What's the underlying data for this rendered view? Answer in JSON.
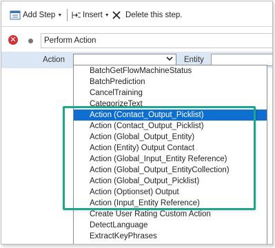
{
  "toolbar": {
    "add_step_label": "Add Step",
    "insert_label": "Insert",
    "delete_label": "Delete this step."
  },
  "step": {
    "title": "Perform Action"
  },
  "params": {
    "action_label": "Action",
    "entity_label": "Entity",
    "action_value": ""
  },
  "dropdown": {
    "options": [
      "BatchGetFlowMachineStatus",
      "BatchPrediction",
      "CancelTraining",
      "CategorizeText",
      "Action (Contact_Output_Picklist)",
      "Action (Contact_Output_Picklist)",
      "Action (Global_Output_Entity)",
      "Action (Entity) Output Contact",
      "Action (Global_Input_Entity Reference)",
      "Action (Global_Output_EntityCollection)",
      "Action (Global_Output_Picklist)",
      "Action (Optionset) Output",
      "Action (Input_Entity Reference)",
      "Create User Rating Custom Action",
      "DetectLanguage",
      "ExtractKeyPhrases"
    ],
    "selected_index": 4
  },
  "colors": {
    "selection": "#0e6fd1",
    "highlight_border": "#1aa78b",
    "params_bg": "#dce7f5",
    "error_icon": "#d13438"
  }
}
